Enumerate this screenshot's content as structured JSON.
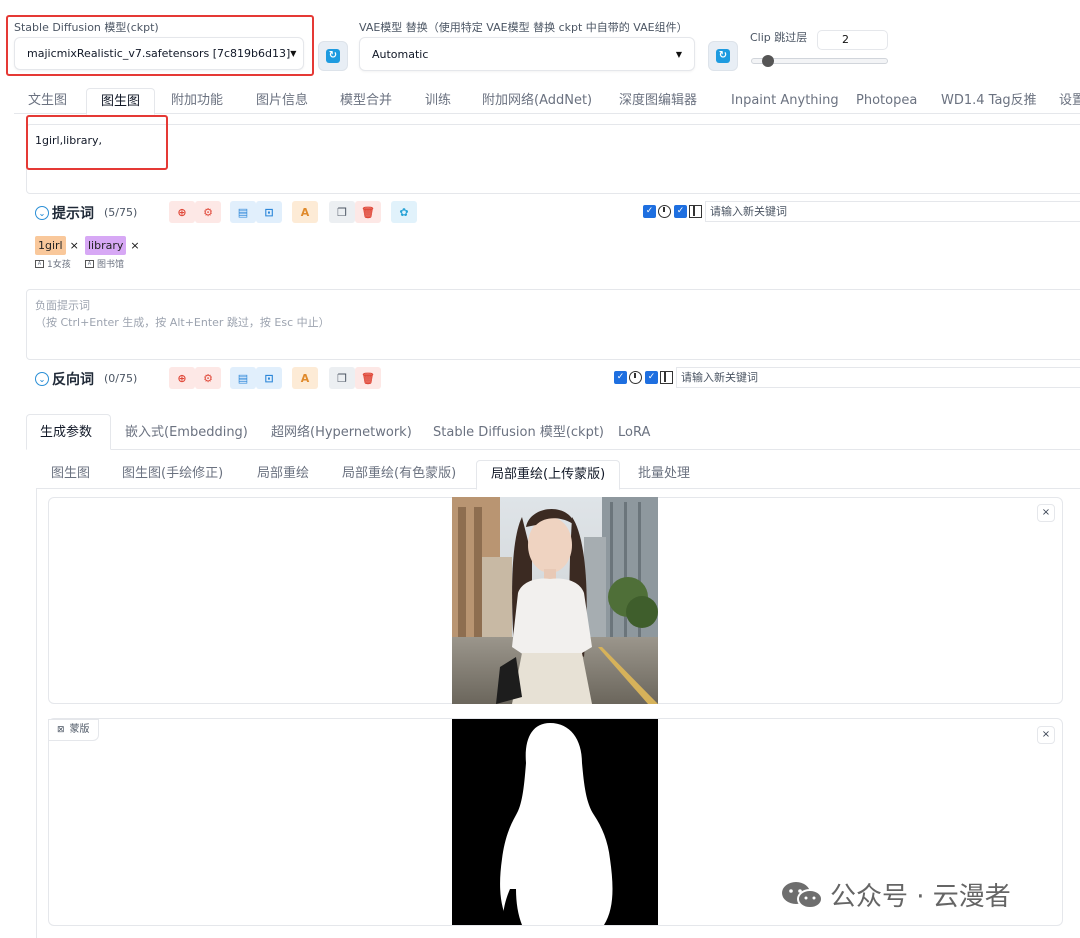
{
  "model_bar": {
    "ckpt_label": "Stable Diffusion 模型(ckpt)",
    "ckpt_value": "majicmixRealistic_v7.safetensors [7c819b6d13]",
    "vae_label": "VAE模型 替换（使用特定 VAE模型 替换 ckpt 中自带的 VAE组件）",
    "vae_value": "Automatic",
    "clip_label": "Clip 跳过层",
    "clip_value": "2",
    "clip_slider_fraction": 0.1
  },
  "main_tabs": [
    "文生图",
    "图生图",
    "附加功能",
    "图片信息",
    "模型合并",
    "训练",
    "附加网络(AddNet)",
    "深度图编辑器",
    "Inpaint Anything",
    "Photopea",
    "WD1.4 Tag反推",
    "设置"
  ],
  "active_main_tab": "图生图",
  "prompt": {
    "text": "1girl,library,",
    "title": "提示词",
    "count": "(5/75)",
    "keyword_placeholder": "请输入新关键词",
    "tags": [
      {
        "label": "1girl",
        "translation": "1女孩",
        "color": "#f9c89b"
      },
      {
        "label": "library",
        "translation": "图书馆",
        "color": "#d7a8f5"
      }
    ]
  },
  "negative": {
    "placeholder_line1": "负面提示词",
    "placeholder_line2": "（按 Ctrl+Enter 生成，按 Alt+Enter 跳过，按 Esc 中止）",
    "title": "反向词",
    "count": "(0/75)",
    "keyword_placeholder": "请输入新关键词"
  },
  "param_tabs": [
    "生成参数",
    "嵌入式(Embedding)",
    "超网络(Hypernetwork)",
    "Stable Diffusion 模型(ckpt)",
    "LoRA"
  ],
  "active_param_tab": "生成参数",
  "img2img_tabs": [
    "图生图",
    "图生图(手绘修正)",
    "局部重绘",
    "局部重绘(有色蒙版)",
    "局部重绘(上传蒙版)",
    "批量处理"
  ],
  "active_img2img_tab": "局部重绘(上传蒙版)",
  "mask_label": "蒙版",
  "close_glyph": "×",
  "watermark": "公众号 · 云漫者",
  "colors": {
    "accent_red": "#e53935",
    "checkbox_blue": "#1e6fe0",
    "refresh_blue": "#1e9be0"
  }
}
